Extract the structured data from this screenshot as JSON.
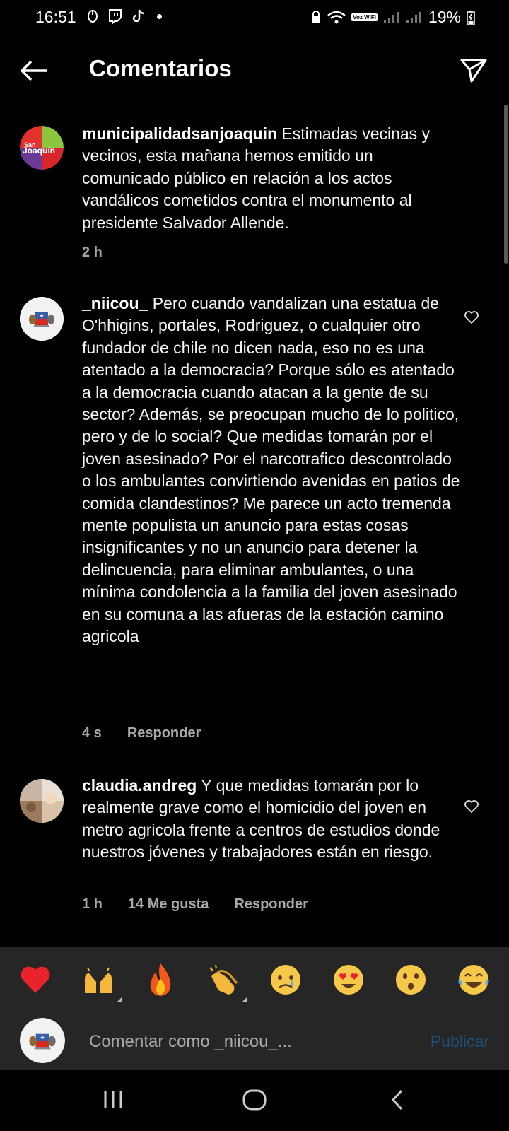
{
  "status_bar": {
    "time": "16:51",
    "battery": "19%",
    "voz_wifi": "Voz WiFi"
  },
  "header": {
    "title": "Comentarios"
  },
  "caption": {
    "username": "municipalidadsanjoaquin",
    "text": " Estimadas vecinas y vecinos, esta mañana hemos emitido un comunicado público en relación a los actos vandálicos cometidos contra el monumento al presidente Salvador Allende.",
    "time": "2 h"
  },
  "comments": [
    {
      "username": "_niicou_",
      "text": " Pero cuando vandalizan una estatua de O'hhigins, portales, Rodriguez, o cualquier otro fundador de chile no dicen nada, eso no es una atentado a la democracia? Porque sólo es atentado a la democracia cuando atacan a la gente de su sector? Además, se preocupan mucho de lo politico, pero y de lo social? Que medidas tomarán por el joven asesinado? Por el narcotrafico descontrolado o los ambulantes convirtiendo avenidas en patios de comida clandestinos? Me parece un acto tremenda mente populista un anuncio para estas cosas insignificantes y no un anuncio para detener la delincuencia, para eliminar ambulantes, o una mínima condolencia a la familia del joven asesinado en su comuna a las afueras de la estación camino agricola",
      "time": "4 s",
      "reply": "Responder"
    },
    {
      "username": "claudia.andreg",
      "text": " Y que medidas tomarán por lo realmente grave como el homicidio del joven en metro agricola frente a centros de estudios donde nuestros jóvenes y trabajadores están en riesgo.",
      "time": "1 h",
      "likes": "14 Me gusta",
      "reply": "Responder"
    }
  ],
  "emoji_bar": {
    "emojis": [
      "heart",
      "raising-hands",
      "fire",
      "clapping-hands",
      "crying-face",
      "heart-eyes",
      "surprised-face",
      "tears-of-joy"
    ]
  },
  "comment_input": {
    "placeholder": "Comentar como _niicou_...",
    "publish_label": "Publicar"
  },
  "colors": {
    "background": "#000000",
    "bottom_bar": "#262626",
    "publish_disabled": "#1f4f7a",
    "muted_text": "#a8a8a8"
  }
}
